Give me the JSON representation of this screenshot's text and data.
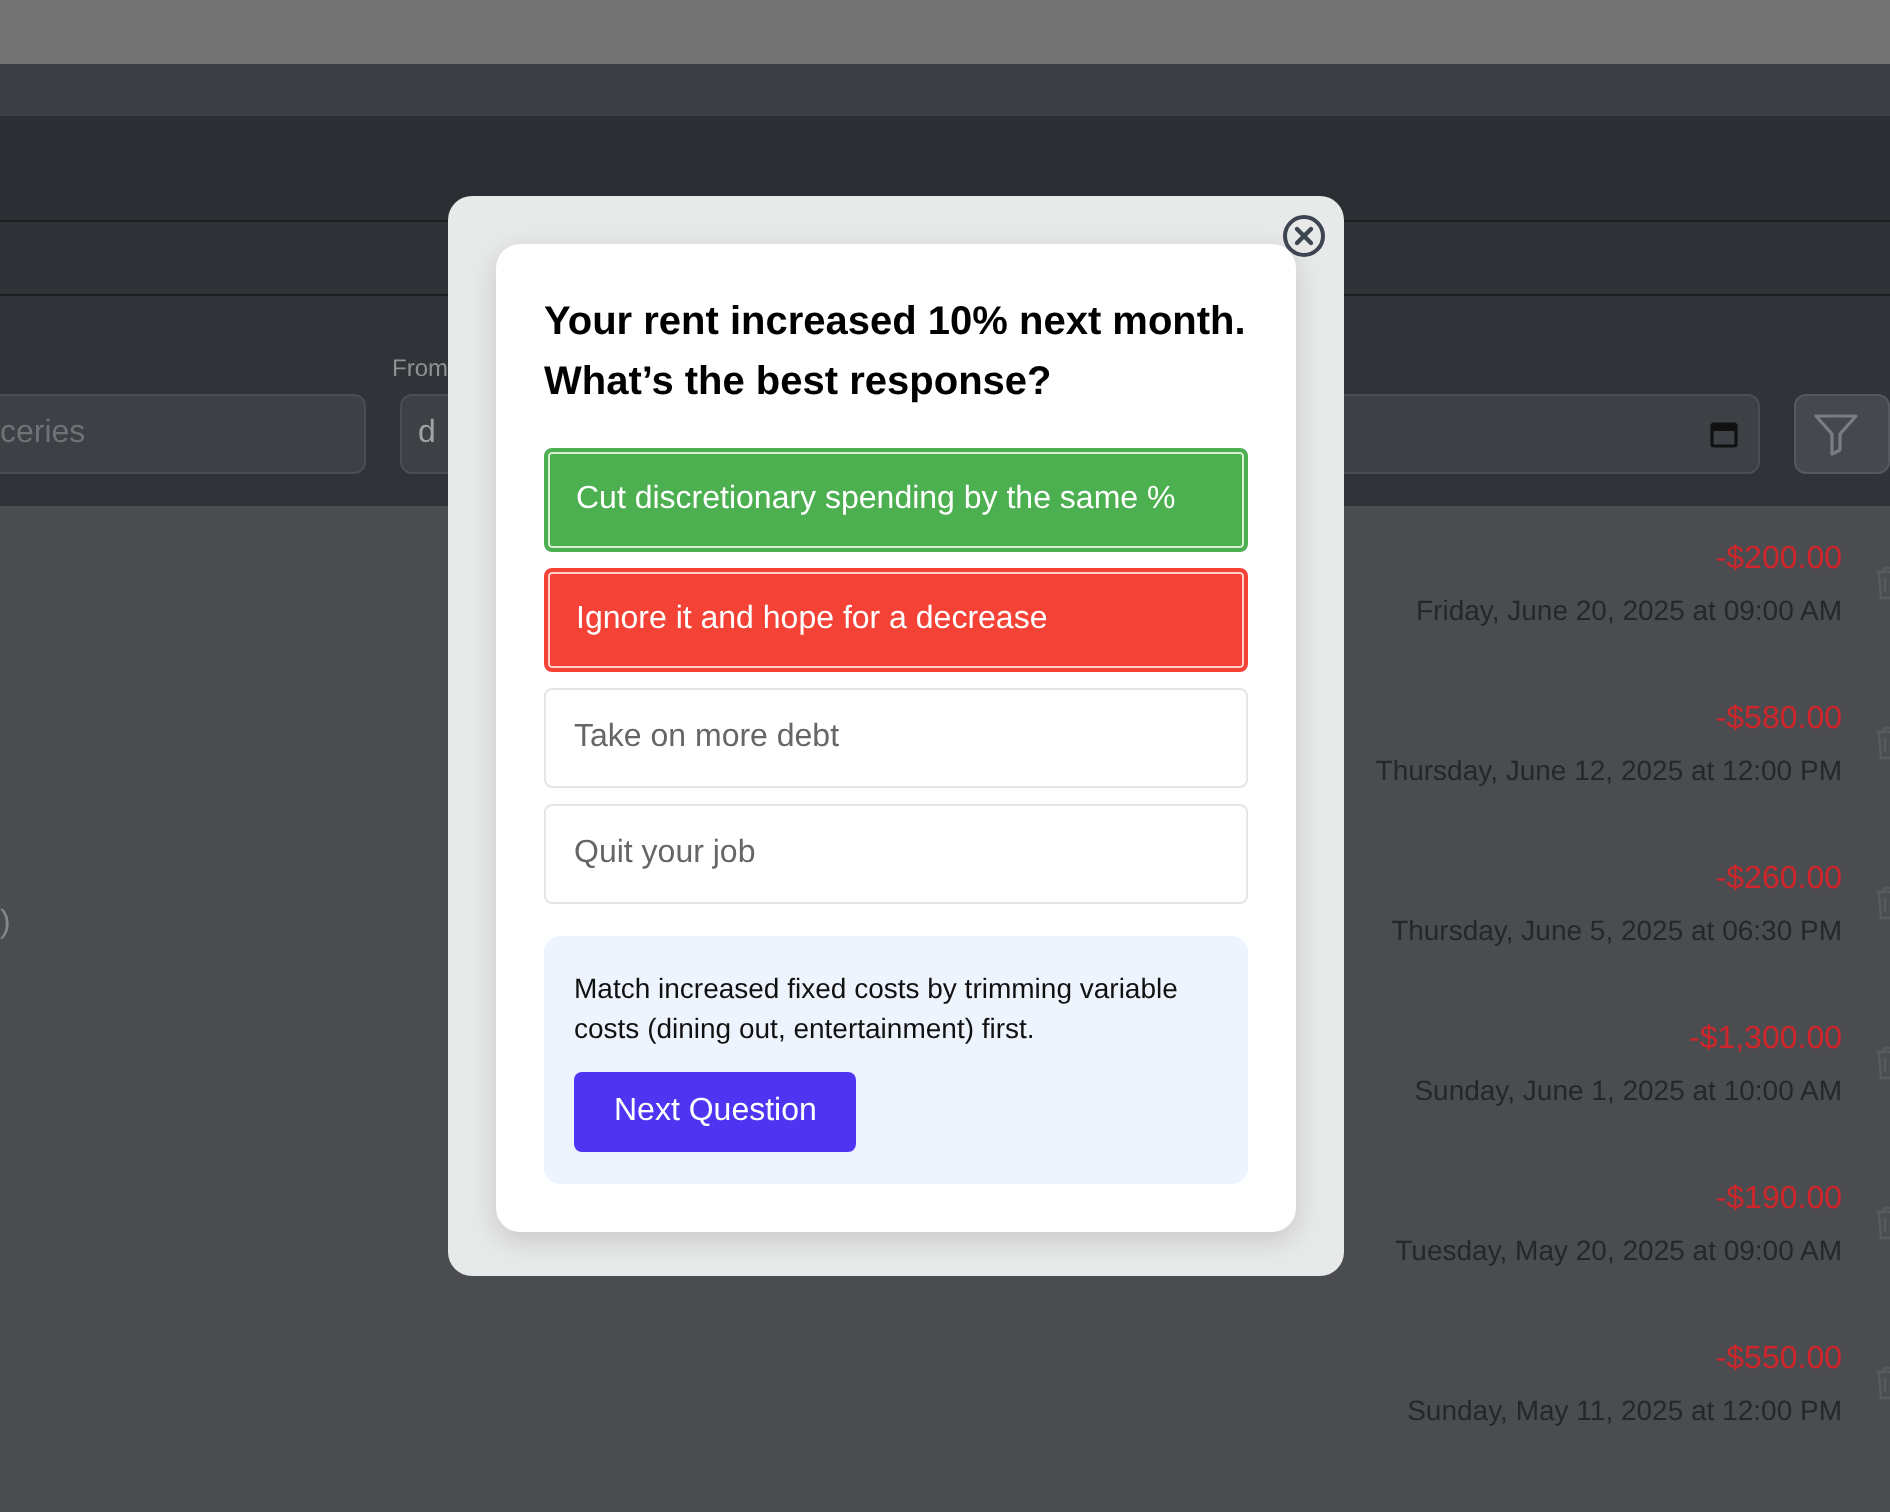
{
  "page": {
    "filters": {
      "search": {
        "placeholder": "ceries"
      },
      "from": {
        "label": "From",
        "value": "d"
      }
    },
    "transactions": [
      {
        "amount": "-$200.00",
        "date": "Friday, June 20, 2025 at 09:00 AM"
      },
      {
        "amount": "-$580.00",
        "date": "Thursday, June 12, 2025 at 12:00 PM"
      },
      {
        "note": ")",
        "amount": "-$260.00",
        "date": "Thursday, June 5, 2025 at 06:30 PM"
      },
      {
        "amount": "-$1,300.00",
        "date": "Sunday, June 1, 2025 at 10:00 AM"
      },
      {
        "amount": "-$190.00",
        "date": "Tuesday, May 20, 2025 at 09:00 AM"
      },
      {
        "amount": "-$550.00",
        "date": "Sunday, May 11, 2025 at 12:00 PM"
      }
    ]
  },
  "modal": {
    "question": "Your rent increased 10% next month. What’s the best response?",
    "options": [
      {
        "label": "Cut discretionary spending by the same %",
        "kind": "correct"
      },
      {
        "label": "Ignore it and hope for a decrease",
        "kind": "wrong"
      },
      {
        "label": "Take on more debt",
        "kind": "neutral"
      },
      {
        "label": "Quit your job",
        "kind": "neutral"
      }
    ],
    "explanation": "Match increased fixed costs by trimming variable costs (dining out, entertainment) first.",
    "next_button": "Next Question"
  }
}
